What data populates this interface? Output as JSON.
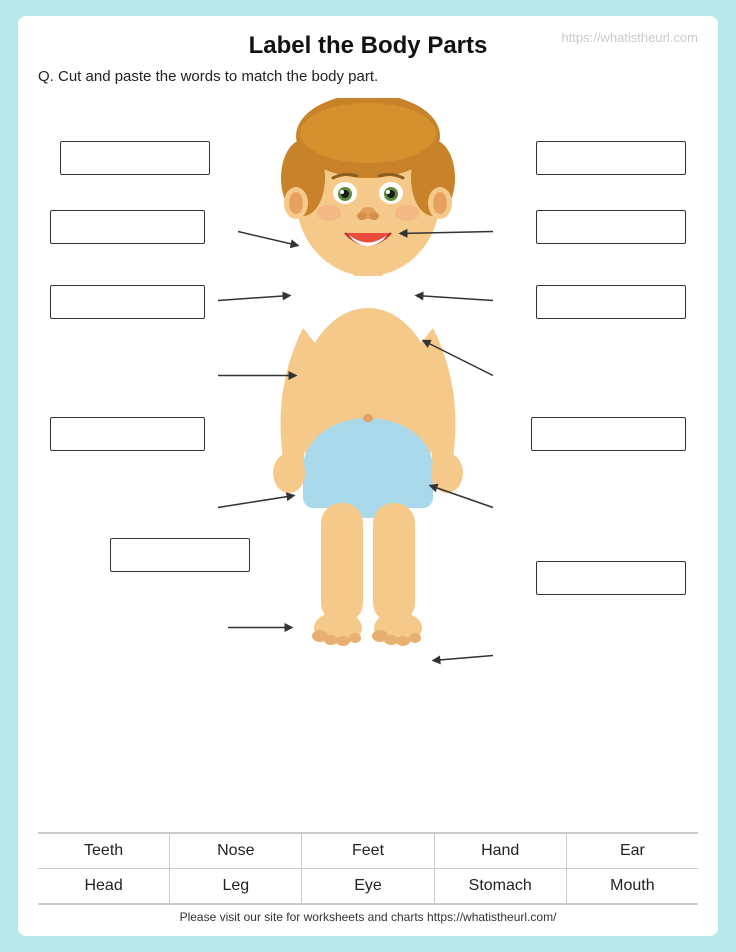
{
  "title": "Label the Body Parts",
  "watermark": "https://whatistheurl.com",
  "question": "Q.  Cut and paste the words to match the body part.",
  "labels": {
    "top_right": "",
    "eye_right": "",
    "ear_right": "",
    "mouth_left": "",
    "nose_left": "",
    "head_left": "",
    "stomach_right": "",
    "belly_left": "",
    "leg_left": "",
    "feet_right": ""
  },
  "word_bank_row1": [
    "Teeth",
    "Nose",
    "Feet",
    "Hand",
    "Ear"
  ],
  "word_bank_row2": [
    "Head",
    "Leg",
    "Eye",
    "Stomach",
    "Mouth"
  ],
  "footer_text": "Please visit our site for worksheets and charts https://whatistheurl.com/"
}
